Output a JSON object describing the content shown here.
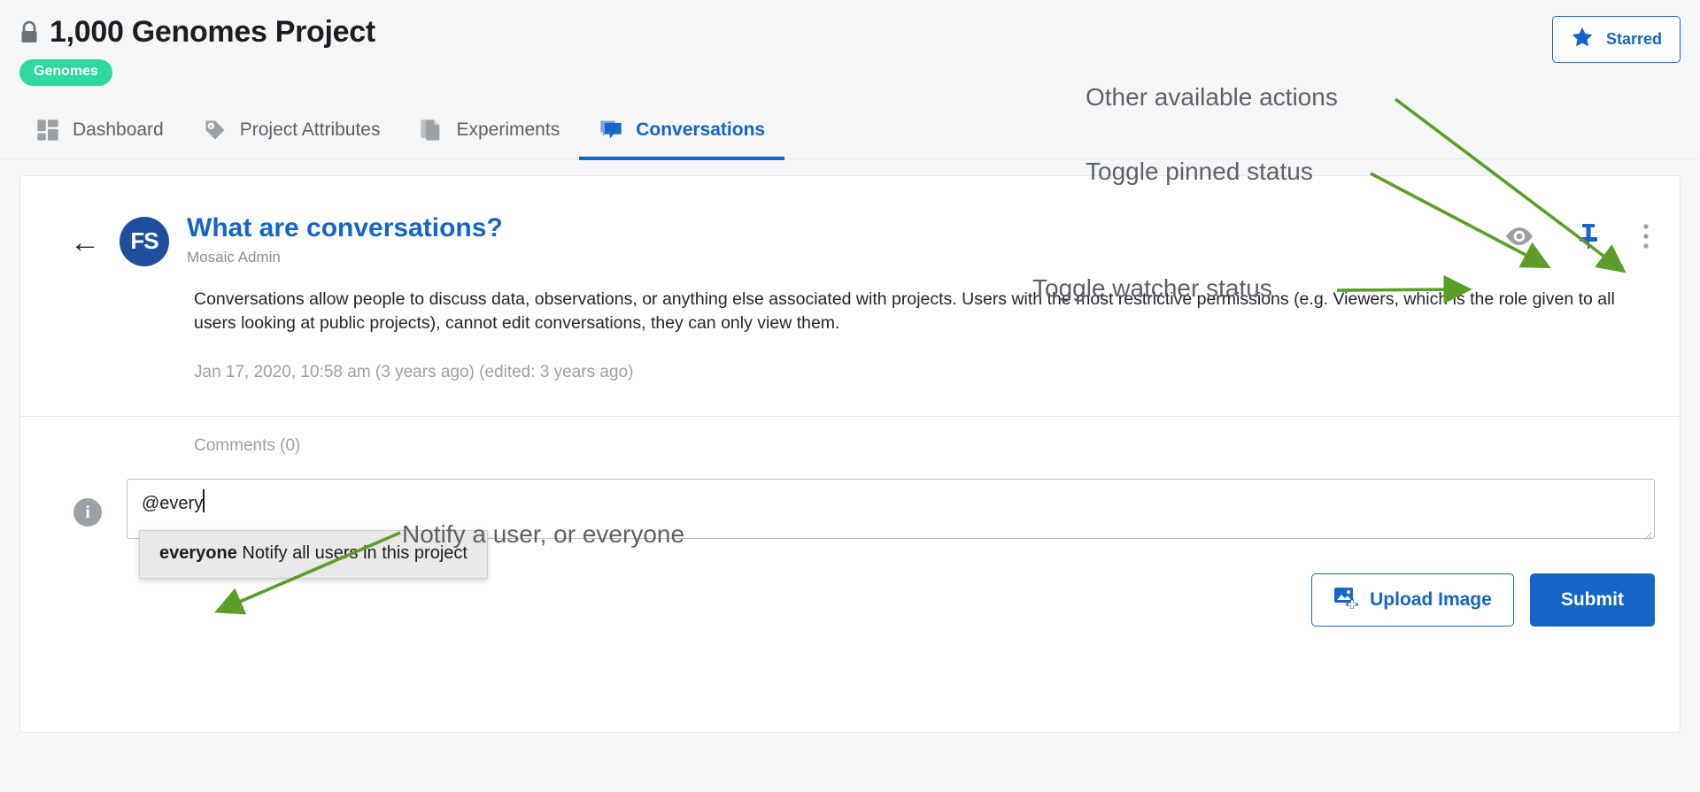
{
  "header": {
    "lock_icon": "lock-icon",
    "title": "1,000 Genomes Project",
    "tag": "Genomes",
    "starred_button": {
      "label": "Starred",
      "icon": "star-icon"
    }
  },
  "tabs": [
    {
      "label": "Dashboard",
      "icon": "dashboard-grid-icon",
      "active": false
    },
    {
      "label": "Project Attributes",
      "icon": "tag-icon",
      "active": false
    },
    {
      "label": "Experiments",
      "icon": "document-icon",
      "active": false
    },
    {
      "label": "Conversations",
      "icon": "chat-bubble-icon",
      "active": true
    }
  ],
  "conversation": {
    "back_icon": "back-arrow-icon",
    "avatar_initials": "FS",
    "title": "What are conversations?",
    "author": "Mosaic Admin",
    "body": "Conversations allow people to discuss data, observations, or anything else associated with projects. Users with the most restrictive permissions (e.g. Viewers, which is the role given to all users looking at public projects), cannot edit conversations, they can only view them.",
    "date": "Jan 17, 2020, 10:58 am (3 years ago) (edited: 3 years ago)",
    "actions": [
      {
        "name": "watcher-toggle",
        "icon": "eye-icon",
        "state": "off"
      },
      {
        "name": "pin-toggle",
        "icon": "pin-icon",
        "state": "on"
      },
      {
        "name": "more-actions",
        "icon": "kebab-menu-icon",
        "state": "off"
      }
    ]
  },
  "comments": {
    "label": "Comments (0)",
    "info_icon": "info-icon",
    "composer": {
      "value": "@every",
      "placeholder": ""
    },
    "mention_dropdown": {
      "name": "everyone",
      "description": "Notify all users in this project"
    },
    "buttons": {
      "upload": {
        "label": "Upload Image",
        "icon": "image-upload-icon"
      },
      "submit": {
        "label": "Submit"
      }
    }
  },
  "annotations": [
    {
      "id": "other-actions",
      "text": "Other available actions"
    },
    {
      "id": "toggle-pinned",
      "text": "Toggle pinned status"
    },
    {
      "id": "toggle-watcher",
      "text": "Toggle watcher status"
    },
    {
      "id": "notify-user",
      "text": "Notify a user, or everyone"
    }
  ],
  "colors": {
    "accent_blue": "#1565c7",
    "tag_green": "#2ed9a0",
    "annotation_green": "#5a9e28",
    "annotation_text": "#5d6166",
    "page_bg": "#f5f6f8"
  }
}
